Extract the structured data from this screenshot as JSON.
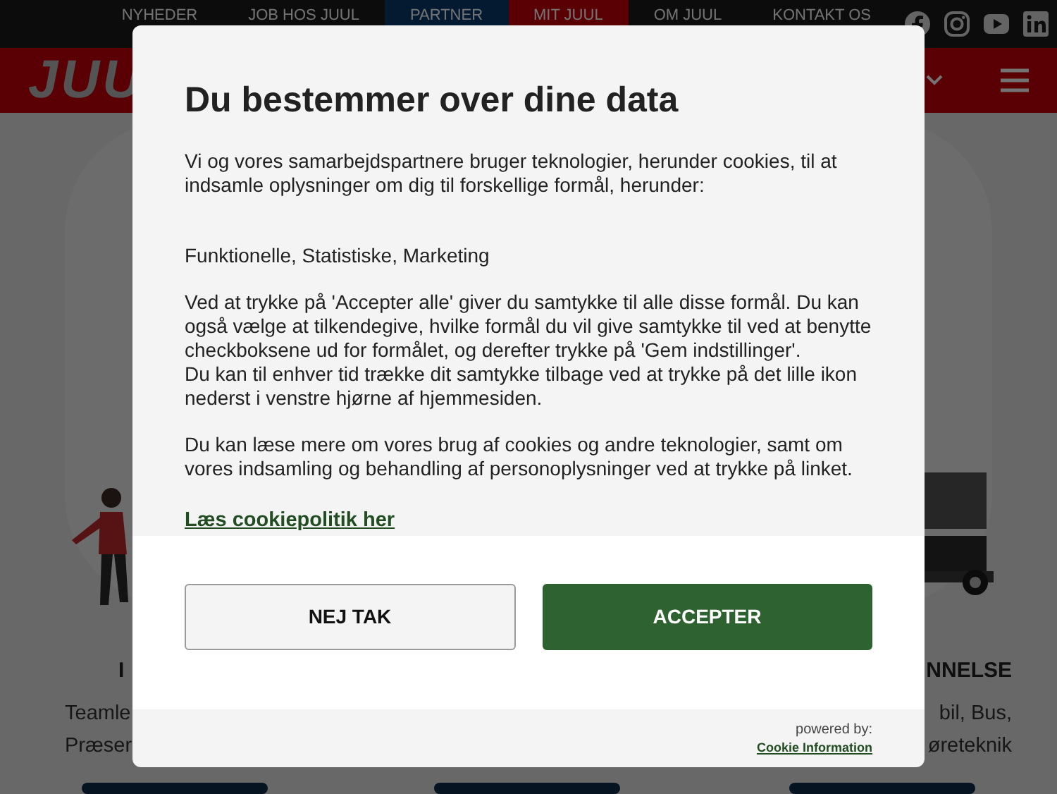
{
  "top_nav": [
    {
      "label": "NYHEDER",
      "kind": "plain"
    },
    {
      "label": "JOB HOS JUUL",
      "kind": "plain"
    },
    {
      "label": "PARTNER",
      "kind": "blue"
    },
    {
      "label": "MIT JUUL",
      "kind": "red"
    },
    {
      "label": "OM JUUL",
      "kind": "plain"
    },
    {
      "label": "KONTAKT OS",
      "kind": "plain"
    }
  ],
  "header": {
    "logo": "JUU"
  },
  "cards": [
    {
      "heading": "I",
      "lines": [
        "Teamle",
        "Præser"
      ],
      "kind": "person"
    },
    {
      "kind": "none"
    },
    {
      "heading": "NNELSE",
      "lines": [
        "bil, Bus,",
        "øreteknik"
      ],
      "kind": "machine"
    }
  ],
  "dialog": {
    "title": "Du bestemmer over dine data",
    "paragraphs": [
      "Vi og vores samarbejdspartnere bruger teknologier, herunder cookies, til at indsamle oplysninger om dig til forskellige formål, herunder:",
      "Funktionelle, Statistiske, Marketing",
      "Ved at trykke på 'Accepter alle' giver du samtykke til alle disse formål. Du kan også vælge at tilkendegive, hvilke formål du vil give samtykke til ved at benytte checkboksene ud for formålet, og derefter trykke på 'Gem indstillinger'.\nDu kan til enhver tid trække dit samtykke tilbage ved at trykke på det lille ikon nederst i venstre hjørne af hjemmesiden.",
      "Du kan læse mere om vores brug af cookies og andre teknologier, samt om vores indsamling og behandling af personoplysninger ved at trykke på linket."
    ],
    "link": "Læs cookiepolitik her",
    "buttons": [
      {
        "label": "NEJ TAK",
        "kind": "secondary"
      },
      {
        "label": "ACCEPTER",
        "kind": "primary"
      }
    ],
    "powered_by": "powered by:",
    "provider_link": "Cookie Information"
  }
}
